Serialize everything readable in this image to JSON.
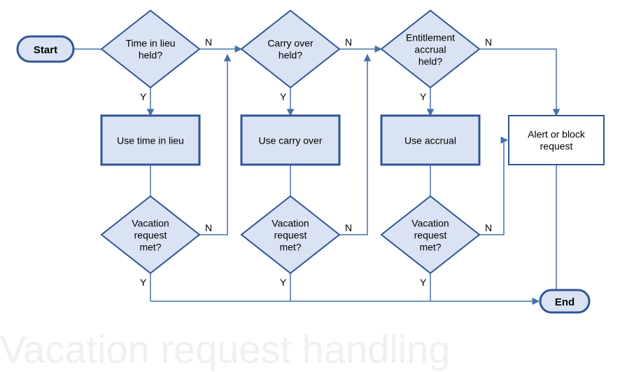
{
  "watermark": "Vacation request handling",
  "nodes": {
    "start": "Start",
    "end": "End",
    "d1_l1": "Time in lieu",
    "d1_l2": "held?",
    "d2_l1": "Carry over",
    "d2_l2": "held?",
    "d3_l1": "Entitlement",
    "d3_l2": "accrual",
    "d3_l3": "held?",
    "p1": "Use time in lieu",
    "p2": "Use carry over",
    "p3": "Use accrual",
    "p4_l1": "Alert or block",
    "p4_l2": "request",
    "d4_l1": "Vacation",
    "d4_l2": "request",
    "d4_l3": "met?",
    "d5_l1": "Vacation",
    "d5_l2": "request",
    "d5_l3": "met?",
    "d6_l1": "Vacation",
    "d6_l2": "request",
    "d6_l3": "met?"
  },
  "labels": {
    "Y": "Y",
    "N": "N"
  },
  "chart_data": {
    "type": "flowchart",
    "title": "Vacation request handling",
    "nodes": [
      {
        "id": "start",
        "type": "terminator",
        "label": "Start"
      },
      {
        "id": "d1",
        "type": "decision",
        "label": "Time in lieu held?"
      },
      {
        "id": "d2",
        "type": "decision",
        "label": "Carry over held?"
      },
      {
        "id": "d3",
        "type": "decision",
        "label": "Entitlement accrual held?"
      },
      {
        "id": "p1",
        "type": "process",
        "label": "Use time in lieu"
      },
      {
        "id": "p2",
        "type": "process",
        "label": "Use carry over"
      },
      {
        "id": "p3",
        "type": "process",
        "label": "Use accrual"
      },
      {
        "id": "p4",
        "type": "process",
        "label": "Alert or block request"
      },
      {
        "id": "d4",
        "type": "decision",
        "label": "Vacation request met?"
      },
      {
        "id": "d5",
        "type": "decision",
        "label": "Vacation request met?"
      },
      {
        "id": "d6",
        "type": "decision",
        "label": "Vacation request met?"
      },
      {
        "id": "end",
        "type": "terminator",
        "label": "End"
      }
    ],
    "edges": [
      {
        "from": "start",
        "to": "d1"
      },
      {
        "from": "d1",
        "to": "p1",
        "label": "Y"
      },
      {
        "from": "d1",
        "to": "d2",
        "label": "N"
      },
      {
        "from": "d2",
        "to": "p2",
        "label": "Y"
      },
      {
        "from": "d2",
        "to": "d3",
        "label": "N"
      },
      {
        "from": "d3",
        "to": "p3",
        "label": "Y"
      },
      {
        "from": "d3",
        "to": "p4",
        "label": "N"
      },
      {
        "from": "p1",
        "to": "d4"
      },
      {
        "from": "p2",
        "to": "d5"
      },
      {
        "from": "p3",
        "to": "d6"
      },
      {
        "from": "d4",
        "to": "end",
        "label": "Y"
      },
      {
        "from": "d4",
        "to": "d2",
        "label": "N"
      },
      {
        "from": "d5",
        "to": "end",
        "label": "Y"
      },
      {
        "from": "d5",
        "to": "d3",
        "label": "N"
      },
      {
        "from": "d6",
        "to": "end",
        "label": "Y"
      },
      {
        "from": "d6",
        "to": "p4",
        "label": "N"
      },
      {
        "from": "p4",
        "to": "end"
      }
    ]
  }
}
